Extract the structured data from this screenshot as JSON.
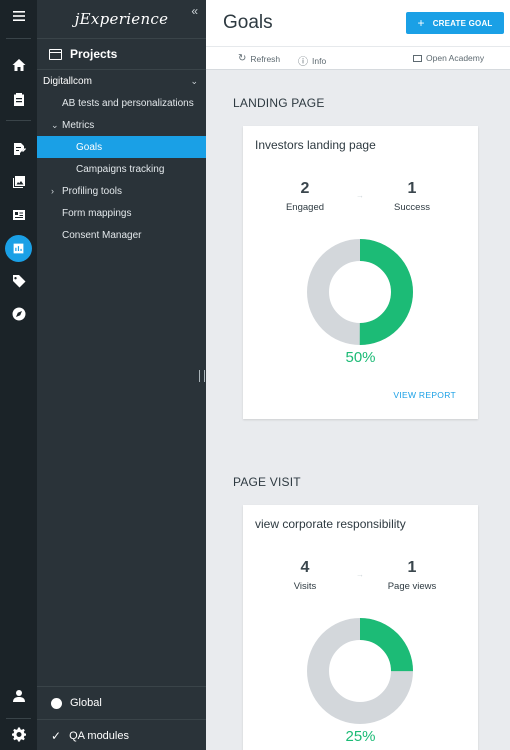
{
  "app": {
    "brand": "jExperience",
    "collapse_glyph": "«"
  },
  "rail": {
    "icons": [
      "menu-icon",
      "home-icon",
      "clipboard-icon",
      "document-edit-icon",
      "images-icon",
      "list-card-icon",
      "chart-icon",
      "tag-icon",
      "compass-icon",
      "user-icon",
      "gear-icon"
    ]
  },
  "sidebar": {
    "projects_label": "Projects",
    "site": "Digitallcom",
    "items": [
      {
        "label": "AB tests and personalizations"
      },
      {
        "label": "Metrics"
      },
      {
        "label": "Goals"
      },
      {
        "label": "Campaigns tracking"
      },
      {
        "label": "Profiling tools"
      },
      {
        "label": "Form mappings"
      },
      {
        "label": "Consent Manager"
      }
    ],
    "global_label": "Global",
    "qa_label": "QA modules"
  },
  "header": {
    "title": "Goals",
    "create_label": "CREATE GOAL",
    "refresh_label": "Refresh",
    "info_label": "Info",
    "academy_label": "Open Academy"
  },
  "sections": [
    {
      "title": "LANDING PAGE",
      "card": {
        "name": "Investors landing page",
        "left_value": "2",
        "left_label": "Engaged",
        "right_value": "1",
        "right_label": "Success",
        "percent_text": "50%",
        "fraction": 0.5,
        "report_label": "VIEW REPORT"
      }
    },
    {
      "title": "PAGE VISIT",
      "card": {
        "name": "view corporate responsibility",
        "left_value": "4",
        "left_label": "Visits",
        "right_value": "1",
        "right_label": "Page views",
        "percent_text": "25%",
        "fraction": 0.25
      }
    }
  ],
  "colors": {
    "accent": "#1aa0e6",
    "success": "#1cbb76",
    "donut_track": "#d3d7db",
    "rail_bg": "#1b2328",
    "panel_bg": "#2a3339"
  }
}
